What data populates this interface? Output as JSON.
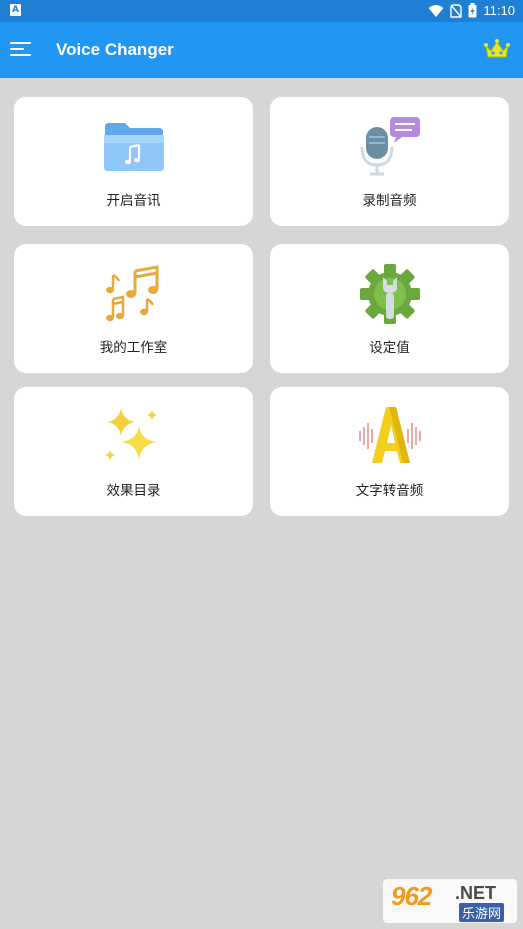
{
  "status_bar": {
    "time": "11:10",
    "notification_icon": "A"
  },
  "app_bar": {
    "title": "Voice Changer",
    "menu_icon": "hamburger-icon",
    "premium_icon": "crown-icon"
  },
  "cards": [
    {
      "label": "开启音讯",
      "icon": "folder-music-icon"
    },
    {
      "label": "录制音频",
      "icon": "microphone-icon"
    },
    {
      "label": "我的工作室",
      "icon": "music-notes-icon"
    },
    {
      "label": "设定值",
      "icon": "gear-wrench-icon"
    },
    {
      "label": "效果目录",
      "icon": "sparkles-icon"
    },
    {
      "label": "文字转音频",
      "icon": "text-to-audio-icon"
    }
  ],
  "watermark": {
    "number": "962",
    "domain": ".NET",
    "site": "乐游网"
  },
  "colors": {
    "app_bar": "#2196f3",
    "status_bar": "#1e7fd4",
    "background": "#d6d6d6",
    "crown": "#e6e62a"
  }
}
